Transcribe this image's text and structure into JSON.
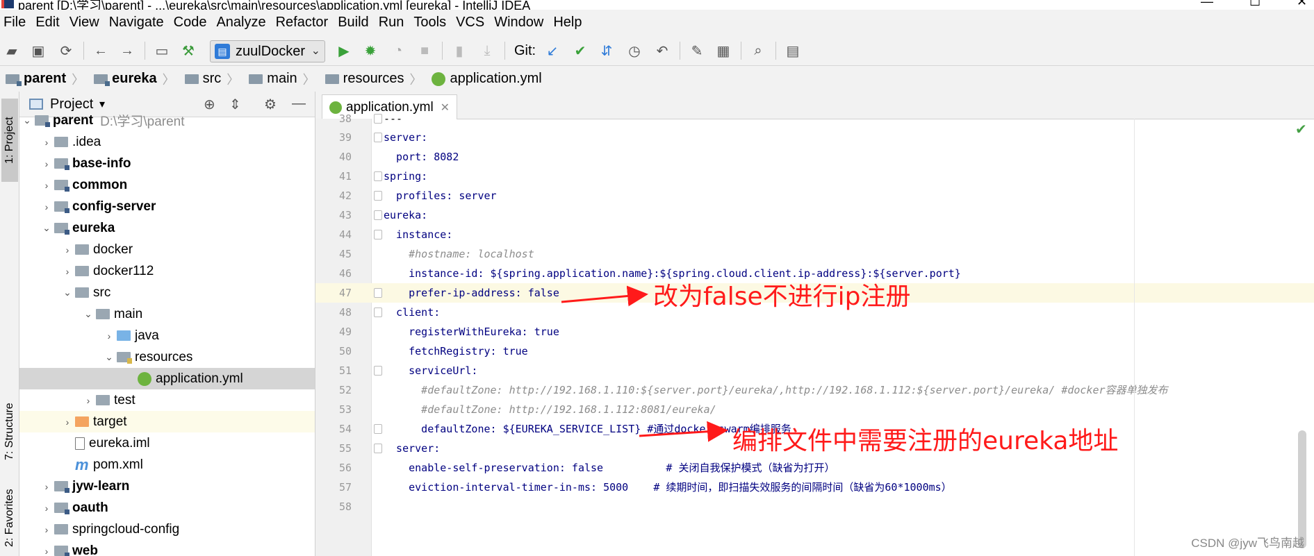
{
  "window": {
    "title": "parent [D:\\学习\\parent] - ...\\eureka\\src\\main\\resources\\application.yml [eureka] - IntelliJ IDEA"
  },
  "menu": [
    "File",
    "Edit",
    "View",
    "Navigate",
    "Code",
    "Analyze",
    "Refactor",
    "Build",
    "Run",
    "Tools",
    "VCS",
    "Window",
    "Help"
  ],
  "toolbar": {
    "run_config": "zuulDocker",
    "git_label": "Git:"
  },
  "breadcrumb": [
    "parent",
    "eureka",
    "src",
    "main",
    "resources",
    "application.yml"
  ],
  "side_tabs": {
    "project": "1: Project",
    "structure": "7: Structure",
    "favorites": "2: Favorites"
  },
  "project_panel": {
    "title": "Project",
    "tree": [
      {
        "label": "parent",
        "hint": "D:\\学习\\parent",
        "bold": true
      },
      {
        "label": ".idea"
      },
      {
        "label": "base-info",
        "bold": true
      },
      {
        "label": "common",
        "bold": true
      },
      {
        "label": "config-server",
        "bold": true
      },
      {
        "label": "eureka",
        "bold": true
      },
      {
        "label": "docker"
      },
      {
        "label": "docker112"
      },
      {
        "label": "src"
      },
      {
        "label": "main"
      },
      {
        "label": "java"
      },
      {
        "label": "resources"
      },
      {
        "label": "application.yml"
      },
      {
        "label": "test"
      },
      {
        "label": "target"
      },
      {
        "label": "eureka.iml"
      },
      {
        "label": "pom.xml"
      },
      {
        "label": "jyw-learn",
        "bold": true
      },
      {
        "label": "oauth",
        "bold": true
      },
      {
        "label": "springcloud-config"
      },
      {
        "label": "web",
        "bold": true
      }
    ]
  },
  "editor": {
    "tab_label": "application.yml",
    "lines": [
      {
        "n": "38",
        "t": "---"
      },
      {
        "n": "39",
        "t": "server:"
      },
      {
        "n": "40",
        "t": "  port: 8082"
      },
      {
        "n": "41",
        "t": "spring:"
      },
      {
        "n": "42",
        "t": "  profiles: server"
      },
      {
        "n": "43",
        "t": "eureka:"
      },
      {
        "n": "44",
        "t": "  instance:"
      },
      {
        "n": "45",
        "t": "    #hostname: localhost"
      },
      {
        "n": "46",
        "t": "    instance-id: ${spring.application.name}:${spring.cloud.client.ip-address}:${server.port}"
      },
      {
        "n": "47",
        "t": "    prefer-ip-address: false"
      },
      {
        "n": "48",
        "t": "  client:"
      },
      {
        "n": "49",
        "t": "    registerWithEureka: true"
      },
      {
        "n": "50",
        "t": "    fetchRegistry: true"
      },
      {
        "n": "51",
        "t": "    serviceUrl:"
      },
      {
        "n": "52",
        "t": "      #defaultZone: http://192.168.1.110:${server.port}/eureka/,http://192.168.1.112:${server.port}/eureka/ #docker容器单独发布"
      },
      {
        "n": "53",
        "t": "      #defaultZone: http://192.168.1.112:8081/eureka/"
      },
      {
        "n": "54",
        "t": "      defaultZone: ${EUREKA_SERVICE_LIST} #通过docker swarm编排服务"
      },
      {
        "n": "55",
        "t": "  server:"
      },
      {
        "n": "56",
        "t": "    enable-self-preservation: false          # 关闭自我保护模式（缺省为打开）"
      },
      {
        "n": "57",
        "t": "    eviction-interval-timer-in-ms: 5000    # 续期时间，即扫描失效服务的间隔时间（缺省为60*1000ms）"
      },
      {
        "n": "58",
        "t": ""
      }
    ]
  },
  "annotations": {
    "a1": "改为false不进行ip注册",
    "a2": "编排文件中需要注册的eureka地址"
  },
  "watermark": "CSDN @jyw飞鸟南越",
  "colors": {
    "annotation": "#ff1a1a",
    "keyword": "#000080",
    "number": "#1750eb",
    "comment": "#8c8c8c"
  }
}
